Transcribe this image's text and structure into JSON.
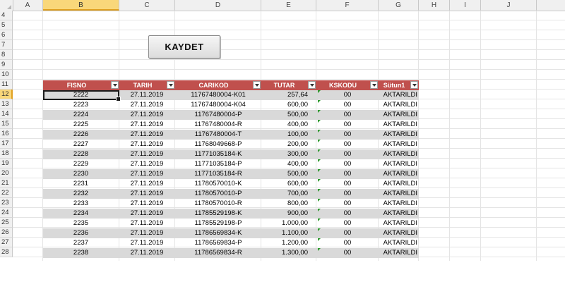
{
  "columns": [
    "A",
    "B",
    "C",
    "D",
    "E",
    "F",
    "G",
    "H",
    "I",
    "J"
  ],
  "rows": [
    "4",
    "5",
    "6",
    "7",
    "8",
    "9",
    "10",
    "11",
    "12",
    "13",
    "14",
    "15",
    "16",
    "17",
    "18",
    "19",
    "20",
    "21",
    "22",
    "23",
    "24",
    "25",
    "26",
    "27",
    "28"
  ],
  "button_label": "KAYDET",
  "table": {
    "headers": [
      "FISNO",
      "TARIH",
      "CARIKOD",
      "TUTAR",
      "KSKODU",
      "Sütun1"
    ],
    "rows": [
      [
        "2222",
        "27.11.2019",
        "11767480004-K01",
        "257,64",
        "00",
        "AKTARILDI"
      ],
      [
        "2223",
        "27.11.2019",
        "11767480004-K04",
        "600,00",
        "00",
        "AKTARILDI"
      ],
      [
        "2224",
        "27.11.2019",
        "11767480004-P",
        "500,00",
        "00",
        "AKTARILDI"
      ],
      [
        "2225",
        "27.11.2019",
        "11767480004-R",
        "400,00",
        "00",
        "AKTARILDI"
      ],
      [
        "2226",
        "27.11.2019",
        "11767480004-T",
        "100,00",
        "00",
        "AKTARILDI"
      ],
      [
        "2227",
        "27.11.2019",
        "11768049668-P",
        "200,00",
        "00",
        "AKTARILDI"
      ],
      [
        "2228",
        "27.11.2019",
        "11771035184-K",
        "300,00",
        "00",
        "AKTARILDI"
      ],
      [
        "2229",
        "27.11.2019",
        "11771035184-P",
        "400,00",
        "00",
        "AKTARILDI"
      ],
      [
        "2230",
        "27.11.2019",
        "11771035184-R",
        "500,00",
        "00",
        "AKTARILDI"
      ],
      [
        "2231",
        "27.11.2019",
        "11780570010-K",
        "600,00",
        "00",
        "AKTARILDI"
      ],
      [
        "2232",
        "27.11.2019",
        "11780570010-P",
        "700,00",
        "00",
        "AKTARILDI"
      ],
      [
        "2233",
        "27.11.2019",
        "11780570010-R",
        "800,00",
        "00",
        "AKTARILDI"
      ],
      [
        "2234",
        "27.11.2019",
        "11785529198-K",
        "900,00",
        "00",
        "AKTARILDI"
      ],
      [
        "2235",
        "27.11.2019",
        "11785529198-P",
        "1.000,00",
        "00",
        "AKTARILDI"
      ],
      [
        "2236",
        "27.11.2019",
        "11786569834-K",
        "1.100,00",
        "00",
        "AKTARILDI"
      ],
      [
        "2237",
        "27.11.2019",
        "11786569834-P",
        "1.200,00",
        "00",
        "AKTARILDI"
      ],
      [
        "2238",
        "27.11.2019",
        "11786569834-R",
        "1.300,00",
        "00",
        "AKTARILDI"
      ]
    ]
  },
  "colors": {
    "header_fill": "#c0504d",
    "band_fill": "#d9d9d9",
    "selection_header": "#f9d77a",
    "error_indicator": "#2e9a2e"
  }
}
